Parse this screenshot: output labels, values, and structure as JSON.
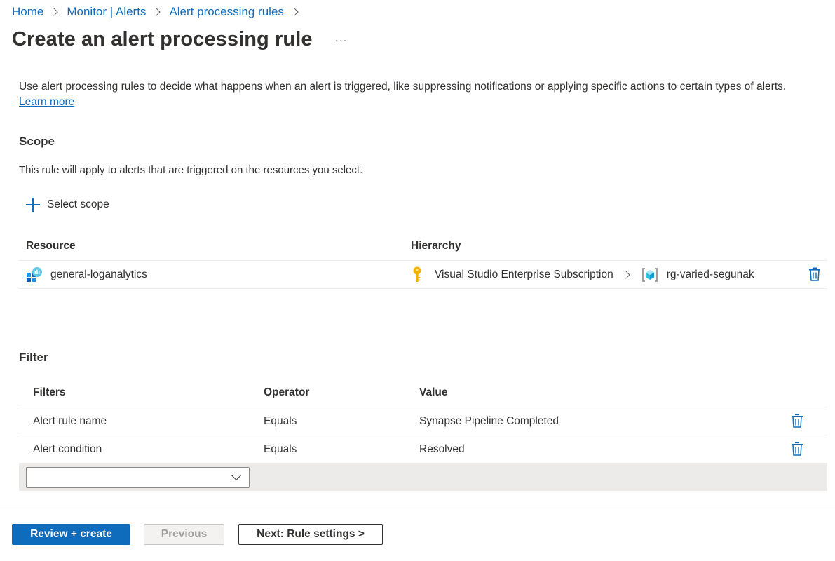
{
  "breadcrumb": {
    "items": [
      "Home",
      "Monitor | Alerts",
      "Alert processing rules"
    ]
  },
  "header": {
    "title": "Create an alert processing rule",
    "more": "···"
  },
  "description": {
    "text": "Use alert processing rules to decide what happens when an alert is triggered, like suppressing notifications or applying specific actions to certain types of alerts.",
    "link": "Learn more"
  },
  "scope": {
    "title": "Scope",
    "subtitle": "This rule will apply to alerts that are triggered on the resources you select.",
    "select_label": "Select scope",
    "columns": [
      "Resource",
      "Hierarchy"
    ],
    "rows": [
      {
        "resource": "general-loganalytics",
        "resource_icon": "log-analytics-icon",
        "subscription": "Visual Studio Enterprise Subscription",
        "subscription_icon": "key-icon",
        "resource_group": "rg-varied-segunak",
        "resource_group_icon": "resource-group-icon"
      }
    ]
  },
  "filter": {
    "title": "Filter",
    "columns": [
      "Filters",
      "Operator",
      "Value"
    ],
    "rows": [
      {
        "filter": "Alert rule name",
        "operator": "Equals",
        "value": "Synapse Pipeline Completed"
      },
      {
        "filter": "Alert condition",
        "operator": "Equals",
        "value": "Resolved"
      }
    ],
    "new_filter_value": ""
  },
  "footer": {
    "review_create": "Review + create",
    "previous": "Previous",
    "next": "Next: Rule settings >"
  },
  "colors": {
    "accent": "#0f6cbd",
    "key": "#f2b200",
    "rg": "#5ec8e5"
  }
}
